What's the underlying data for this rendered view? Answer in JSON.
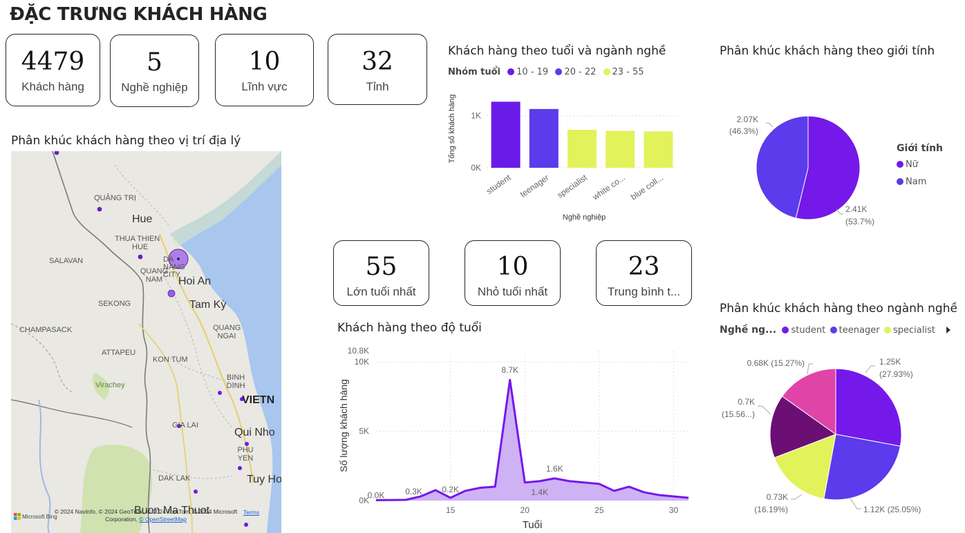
{
  "header": {
    "title": "ĐẶC TRƯNG KHÁCH HÀNG"
  },
  "kpis_top": [
    {
      "value": "4479",
      "label": "Khách hàng"
    },
    {
      "value": "5",
      "label": "Nghề nghiệp"
    },
    {
      "value": "10",
      "label": "Lĩnh vực"
    },
    {
      "value": "32",
      "label": "Tỉnh"
    }
  ],
  "kpis_age": [
    {
      "value": "55",
      "label": "Lớn tuổi nhất"
    },
    {
      "value": "10",
      "label": "Nhỏ tuổi nhất"
    },
    {
      "value": "23",
      "label": "Trung bình t..."
    }
  ],
  "map": {
    "title": "Phân khúc khách hàng theo vị trí địa lý",
    "labels": {
      "quang_tri": "QUẢNG TRỊ",
      "hue": "Hue",
      "thua_thien": "THUA THIEN",
      "hue_prov": "HUE",
      "salavan": "SALAVAN",
      "da_nang": "DA NANG CITY",
      "quang_nam": "QUANG NAM",
      "hoi_an": "Hoi An",
      "sekong": "SEKONG",
      "tam_ky": "Tam Kỳ",
      "champasack": "CHAMPASACK",
      "quang_ngai": "QUANG NGAI",
      "attapeu": "ATTAPEU",
      "kon_tum": "KON TUM",
      "binh_dinh": "BINH DINH",
      "virachey": "Virachey",
      "vietnam": "VIETN",
      "gia_lai": "GIA LAI",
      "qui_nhon": "Qui Nho",
      "phu_yen": "PHU YEN",
      "dak_lak": "DAK LAK",
      "tuy_hoa": "Tuy Hoa",
      "buon_ma_thuot": "Buon Ma Thuot"
    },
    "attribution": "© 2024 NavInfo, © 2024 GeoTrust, © 2024 TomTom, © 2024 Microsoft Corporation,",
    "osm_link": "© OpenStreetMap",
    "terms_link": "Terms",
    "bing_logo": "Microsoft Bing"
  },
  "age_job_chart": {
    "title": "Khách hàng theo tuổi và ngành nghề",
    "legend_title": "Nhóm tuổi",
    "legend": [
      {
        "name": "10 - 19",
        "color": "#6B1BE8"
      },
      {
        "name": "20 - 22",
        "color": "#5B3BEB"
      },
      {
        "name": "23 - 55",
        "color": "#E2F25A"
      }
    ]
  },
  "gender_chart": {
    "title": "Phân khúc khách hàng theo giới tính",
    "legend_title": "Giới tính",
    "legend": [
      {
        "name": "Nữ",
        "color": "#7518EA"
      },
      {
        "name": "Nam",
        "color": "#5B3BEB"
      }
    ]
  },
  "job_pie_chart": {
    "title": "Phân khúc khách hàng theo ngành nghề",
    "legend_title": "Nghề ng...",
    "legend": [
      {
        "name": "student",
        "color": "#7518EA"
      },
      {
        "name": "teenager",
        "color": "#5B3BEB"
      },
      {
        "name": "specialist",
        "color": "#E2F25A"
      }
    ],
    "legend_next_icon": "chevron-right-icon"
  },
  "age_chart": {
    "title": "Khách hàng theo độ tuổi"
  },
  "chart_data": [
    {
      "id": "age_job",
      "type": "bar",
      "title": "Khách hàng theo tuổi và ngành nghề",
      "xlabel": "Nghề nghiệp",
      "ylabel": "Tổng số khách hàng",
      "categories": [
        "student",
        "teenager",
        "specialist",
        "white co...",
        "blue coll..."
      ],
      "values": [
        1270,
        1130,
        730,
        710,
        700
      ],
      "bar_groups": [
        "10 - 19",
        "20 - 22",
        "23 - 55",
        "23 - 55",
        "23 - 55"
      ],
      "ylim": [
        0,
        1500
      ],
      "yticks": [
        {
          "v": 0,
          "label": "0K"
        },
        {
          "v": 1000,
          "label": "1K"
        }
      ]
    },
    {
      "id": "gender",
      "type": "pie",
      "title": "Phân khúc khách hàng theo giới tính",
      "slices": [
        {
          "name": "Nữ",
          "value": 2410,
          "label": "2.41K",
          "pct": "(53.7%)",
          "color": "#7518EA"
        },
        {
          "name": "Nam",
          "value": 2070,
          "label": "2.07K",
          "pct": "(46.3%)",
          "color": "#5B3BEB"
        }
      ]
    },
    {
      "id": "jobs",
      "type": "pie",
      "title": "Phân khúc khách hàng theo ngành nghề",
      "slices": [
        {
          "name": "student",
          "value": 1250,
          "label": "1.25K",
          "pct": "(27.93%)",
          "color": "#7518EA"
        },
        {
          "name": "teenager",
          "value": 1120,
          "label": "1.12K (25.05%)",
          "pct": "",
          "color": "#5B3BEB"
        },
        {
          "name": "specialist",
          "value": 730,
          "label": "0.73K",
          "pct": "(16.19%)",
          "color": "#E2F25A"
        },
        {
          "name": "",
          "value": 700,
          "label": "0.7K",
          "pct": "(15.56...)",
          "color": "#6B0F74"
        },
        {
          "name": "",
          "value": 680,
          "label": "0.68K (15.27%)",
          "pct": "",
          "color": "#E044A7"
        }
      ]
    },
    {
      "id": "age",
      "type": "area",
      "title": "Khách hàng theo độ tuổi",
      "xlabel": "Tuổi",
      "ylabel": "Số lượng khách hàng",
      "x": [
        10,
        11,
        12,
        13,
        14,
        15,
        16,
        17,
        18,
        19,
        20,
        21,
        22,
        23,
        24,
        25,
        26,
        27,
        28,
        29,
        30,
        31
      ],
      "values": [
        30,
        40,
        50,
        300,
        750,
        200,
        700,
        920,
        1000,
        8700,
        1300,
        1400,
        1600,
        1400,
        1300,
        1200,
        700,
        1000,
        600,
        400,
        300,
        200
      ],
      "xlim": [
        10,
        31
      ],
      "ylim": [
        0,
        10800
      ],
      "yticks": [
        {
          "v": 0,
          "label": "0K"
        },
        {
          "v": 5000,
          "label": "5K"
        },
        {
          "v": 10000,
          "label": "10K"
        },
        {
          "v": 10800,
          "label": "10.8K"
        }
      ],
      "xticks": [
        15,
        20,
        25,
        30
      ],
      "data_labels": [
        {
          "x": 10,
          "v": 30,
          "label": "0.0K"
        },
        {
          "x": 13,
          "v": 300,
          "label": "0.3K"
        },
        {
          "x": 15,
          "v": 200,
          "label": "0.2K"
        },
        {
          "x": 19,
          "v": 8700,
          "label": "8.7K"
        },
        {
          "x": 22,
          "v": 1600,
          "label": "1.6K"
        },
        {
          "x": 21,
          "v": 1400,
          "label": "1.4K"
        }
      ],
      "color": "#7518EA",
      "fill": "#C5A5F2"
    }
  ]
}
